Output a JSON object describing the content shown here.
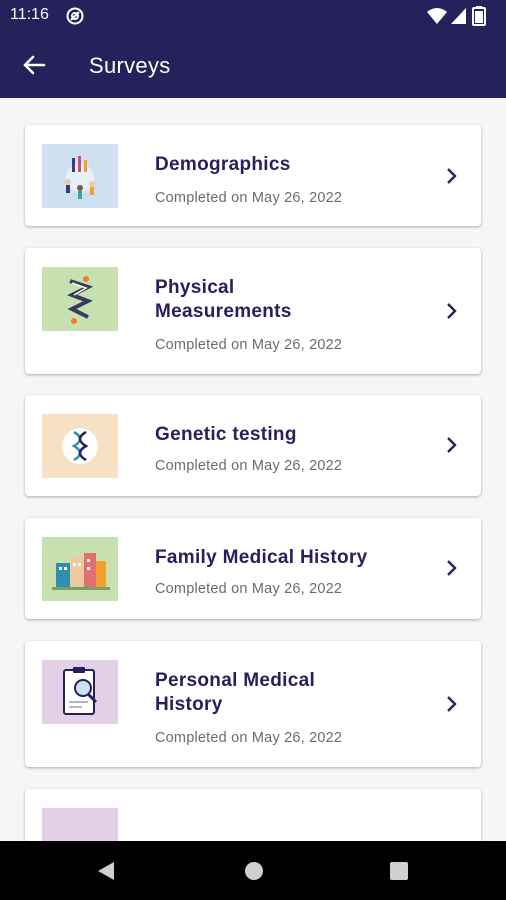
{
  "status_bar": {
    "time": "11:16",
    "app_icon": "at-sign-icon",
    "icons": [
      "wifi-icon",
      "signal-icon",
      "battery-icon"
    ]
  },
  "app_bar": {
    "title": "Surveys",
    "back_icon": "arrow-left-icon"
  },
  "surveys": [
    {
      "title_line1": "Demographics",
      "title_line2": "",
      "status": "Completed on May 26, 2022",
      "thumb_bg": "#cfe0f1"
    },
    {
      "title_line1": "Physical",
      "title_line2": "Measurements",
      "status": "Completed on May 26, 2022",
      "thumb_bg": "#c6e0b0"
    },
    {
      "title_line1": "Genetic testing",
      "title_line2": "",
      "status": "Completed on May 26, 2022",
      "thumb_bg": "#f6e1c5"
    },
    {
      "title_line1": "Family Medical History",
      "title_line2": "",
      "status": "Completed on May 26, 2022",
      "thumb_bg": "#c6e0b0"
    },
    {
      "title_line1": "Personal Medical",
      "title_line2": "History",
      "status": "Completed on May 26, 2022",
      "thumb_bg": "#e3cfe6"
    }
  ],
  "nav_bar": {
    "icons": [
      "nav-back-icon",
      "nav-home-icon",
      "nav-recents-icon"
    ]
  },
  "colors": {
    "primary": "#25215a",
    "text_secondary": "#6b6b70",
    "background": "#f6f6f6",
    "card": "#ffffff"
  }
}
